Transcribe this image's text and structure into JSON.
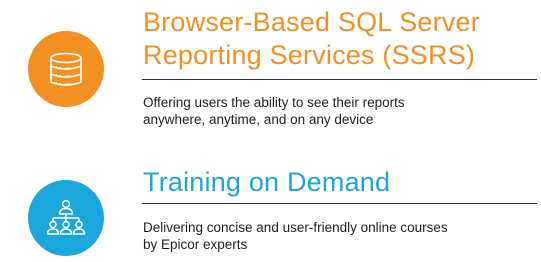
{
  "colors": {
    "orange": "#f39021",
    "blue": "#1ba6dc",
    "text": "#1f1f1f",
    "rule": "#2b2b2b"
  },
  "features": [
    {
      "icon": "database-server-icon",
      "title_line1": "Browser-Based SQL Server",
      "title_line2": "Reporting Services (SSRS)",
      "description_line1": "Offering users the ability to see their reports",
      "description_line2": "anywhere, anytime, and on any device"
    },
    {
      "icon": "team-hierarchy-icon",
      "title_line1": "Training on Demand",
      "description_line1": "Delivering concise and user-friendly online courses",
      "description_line2": "by Epicor experts"
    }
  ]
}
